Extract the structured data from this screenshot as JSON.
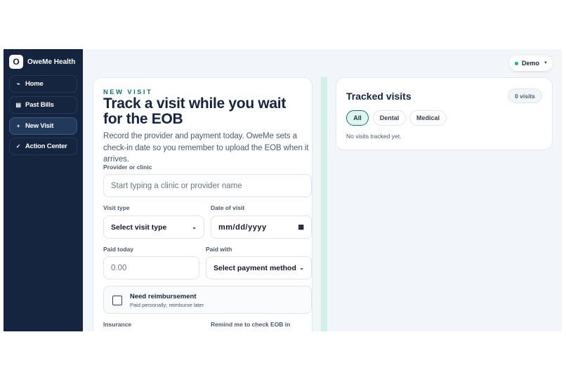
{
  "brand": {
    "logo_letter": "O",
    "name": "OweMe Health"
  },
  "sidebar": {
    "items": [
      {
        "label": "Home",
        "icon": "home-icon",
        "glyph": "⌁",
        "active": false
      },
      {
        "label": "Past Bills",
        "icon": "list-icon",
        "glyph": "▤",
        "active": false
      },
      {
        "label": "New Visit",
        "icon": "plus-icon",
        "glyph": "+",
        "active": true
      },
      {
        "label": "Action Center",
        "icon": "check-icon",
        "glyph": "✓",
        "active": false
      }
    ]
  },
  "header": {
    "account_label": "Demo",
    "status_color": "#10b981"
  },
  "visit_form": {
    "eyebrow": "NEW VISIT",
    "title": "Track a visit while you wait for the EOB",
    "description": "Record the provider and payment today. OweMe sets a check-in date so you remember to upload the EOB when it arrives.",
    "provider_label": "Provider or clinic",
    "provider_placeholder": "Start typing a clinic or provider name",
    "visit_type_label": "Visit type",
    "visit_type_value": "Select visit type",
    "date_label": "Date of visit",
    "date_value": "mm/dd/yyyy",
    "paid_today_label": "Paid today",
    "paid_today_placeholder": "0.00",
    "paid_with_label": "Paid with",
    "paid_with_value": "Select payment method",
    "reimbursement_title": "Need reimbursement",
    "reimbursement_subtitle": "Paid personally; reimburse later",
    "reimbursement_checked": false,
    "insurance_label": "Insurance",
    "remind_label": "Remind me to check EOB in"
  },
  "tracked": {
    "title": "Tracked visits",
    "count_label": "0 visits",
    "filters": [
      "All",
      "Dental",
      "Medical"
    ],
    "active_filter": "All",
    "empty_text": "No visits tracked yet."
  },
  "colors": {
    "sidebar_bg": "#15253f",
    "accent": "#0f766e",
    "accent_soft": "#d3f0e8",
    "status_dot": "#10b981"
  }
}
